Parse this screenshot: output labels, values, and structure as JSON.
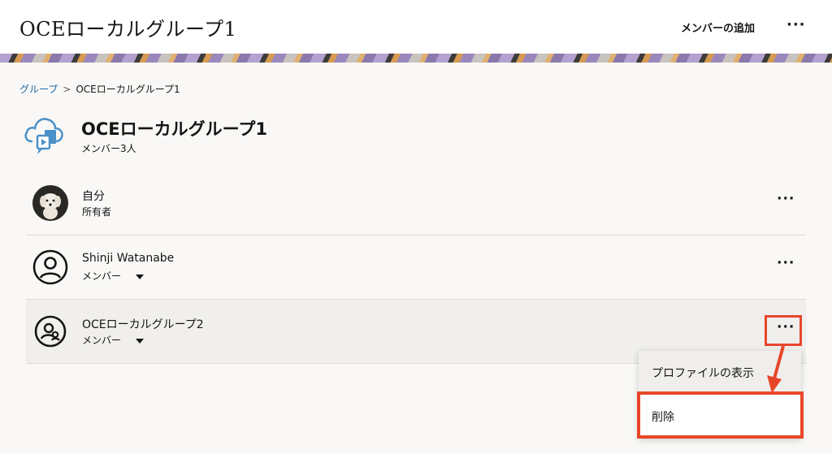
{
  "header": {
    "title": "OCEローカルグループ1",
    "add_member_label": "メンバーの追加",
    "more_label": "···"
  },
  "breadcrumb": {
    "parent": "グループ",
    "separator": ">",
    "current": "OCEローカルグループ1"
  },
  "group": {
    "icon": "cloud-chat-icon",
    "title": "OCEローカルグループ1",
    "member_count": "メンバー3人"
  },
  "members": [
    {
      "name": "自分",
      "role": "所有者",
      "avatar": "dog-photo",
      "has_role_dropdown": false,
      "more_label": "···"
    },
    {
      "name": "Shinji Watanabe",
      "role": "メンバー",
      "avatar": "person-icon",
      "has_role_dropdown": true,
      "more_label": "···"
    },
    {
      "name": "OCEローカルグループ2",
      "role": "メンバー",
      "avatar": "group-icon",
      "has_role_dropdown": true,
      "more_label": "···"
    }
  ],
  "context_menu": {
    "items": [
      "プロファイルの表示",
      "削除"
    ]
  },
  "colors": {
    "accent_link": "#1f6aa5",
    "highlight": "#e8462b",
    "group_icon_blue": "#4a90c8"
  }
}
